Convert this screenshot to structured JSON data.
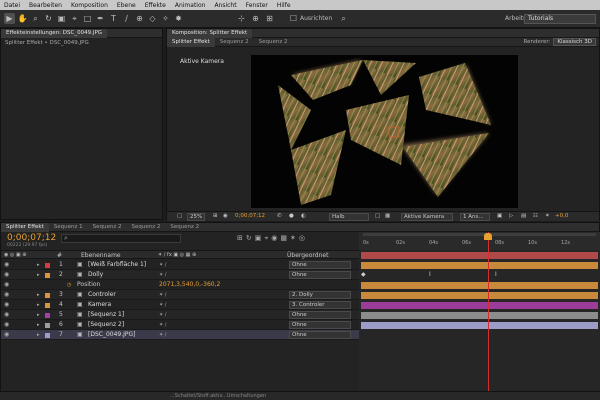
{
  "menu": [
    "Datei",
    "Bearbeiten",
    "Komposition",
    "Ebene",
    "Effekte",
    "Animation",
    "Ansicht",
    "Fenster",
    "Hilfe"
  ],
  "toolbar": {
    "snap_label": "Ausrichten",
    "workspace_label": "Arbeitsbereich:",
    "workspace_value": "Tutorials"
  },
  "effects_panel": {
    "tab_label": "Effekteinstellungen: DSC_0049.JPG",
    "breadcrumb": "Splitter Effekt • DSC_0049.JPG"
  },
  "comp_panel": {
    "tab_label": "Komposition: Splitter Effekt",
    "subtabs": [
      "Splitter Effekt",
      "Sequenz 2",
      "Sequenz 2"
    ],
    "renderer_label": "Renderer:",
    "renderer_value": "Klassisch 3D",
    "camera_label": "Aktive Kamera",
    "zoom": "25%",
    "timecode": "0;00;07;12",
    "resolution": "Halb",
    "view": "Aktive Kamera",
    "views_count": "1 Ans...",
    "exposure": "+0,0"
  },
  "timeline": {
    "tabs": [
      "Splitter Effekt",
      "Sequenz 1",
      "Sequenz 2",
      "Sequenz 2",
      "Sequenz 2"
    ],
    "timecode": "0;00;07;12",
    "timecode_sub": "00222 (29.97 fps)",
    "col_layer_name": "Ebenenname",
    "col_parent": "Übergeordnet",
    "ruler": [
      "0s",
      "02s",
      "04s",
      "06s",
      "08s",
      "10s",
      "12s"
    ],
    "layers": [
      {
        "num": "1",
        "name": "[Weiß Farbfläche 1]",
        "color": "#d83c3c",
        "parent": "Ohne"
      },
      {
        "num": "2",
        "name": "Dolly",
        "color": "#d8953c",
        "parent": "Ohne"
      },
      {
        "num": "",
        "name": "Position",
        "color": "",
        "parent": "",
        "value": "2071,3,540,0,-360,2"
      },
      {
        "num": "3",
        "name": "Controler",
        "color": "#d8953c",
        "parent": "2. Dolly"
      },
      {
        "num": "4",
        "name": "Kamera",
        "color": "#d8953c",
        "parent": "3. Controler"
      },
      {
        "num": "5",
        "name": "[Sequenz 1]",
        "color": "#a83ca8",
        "parent": "Ohne"
      },
      {
        "num": "6",
        "name": "[Sequenz 2]",
        "color": "#9c9c9c",
        "parent": "Ohne"
      },
      {
        "num": "7",
        "name": "[DSC_0049.JPG]",
        "color": "#9c9cc8",
        "parent": "Ohne"
      }
    ]
  },
  "status": {
    "path": "...Schaltet/Stoff.aktiv...Umschaltungen"
  },
  "colors": {
    "accent": "#e8a030",
    "playhead": "#d23030"
  }
}
